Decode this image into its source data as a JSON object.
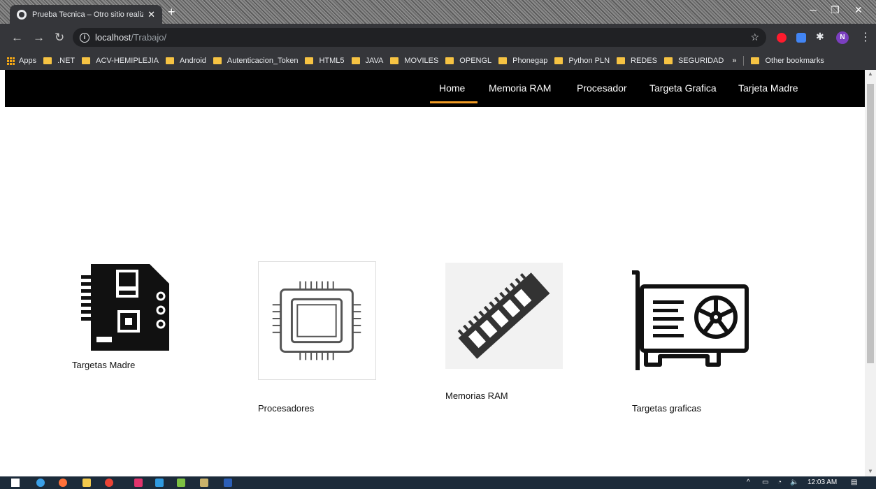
{
  "browser": {
    "tab_title": "Prueba Tecnica – Otro sitio realiz",
    "tab_close": "✕",
    "new_tab": "+",
    "url_host": "localhost",
    "url_path": "/Trabajo/",
    "profile_initial": "N",
    "bookmarks": [
      "Apps",
      ".NET",
      "ACV-HEMIPLEJIA",
      "Android",
      "Autenticacion_Token",
      "HTML5",
      "JAVA",
      "MOVILES",
      "OPENGL",
      "Phonegap",
      "Python PLN",
      "REDES",
      "SEGURIDAD"
    ],
    "bookmarks_overflow": "»",
    "other_bookmarks": "Other bookmarks"
  },
  "site": {
    "nav": [
      "Home",
      "Memoria RAM",
      "Procesador",
      "Targeta Grafica",
      "Tarjeta Madre"
    ],
    "active_nav": "Home",
    "accent_color": "#f09a23",
    "cards": [
      {
        "label": "Targetas Madre",
        "icon": "motherboard-icon"
      },
      {
        "label": "Procesadores",
        "icon": "cpu-icon"
      },
      {
        "label": "Memorias RAM",
        "icon": "ram-icon"
      },
      {
        "label": "Targetas graficas",
        "icon": "graphics-card-icon"
      }
    ]
  },
  "taskbar": {
    "time": "12:03 AM"
  }
}
